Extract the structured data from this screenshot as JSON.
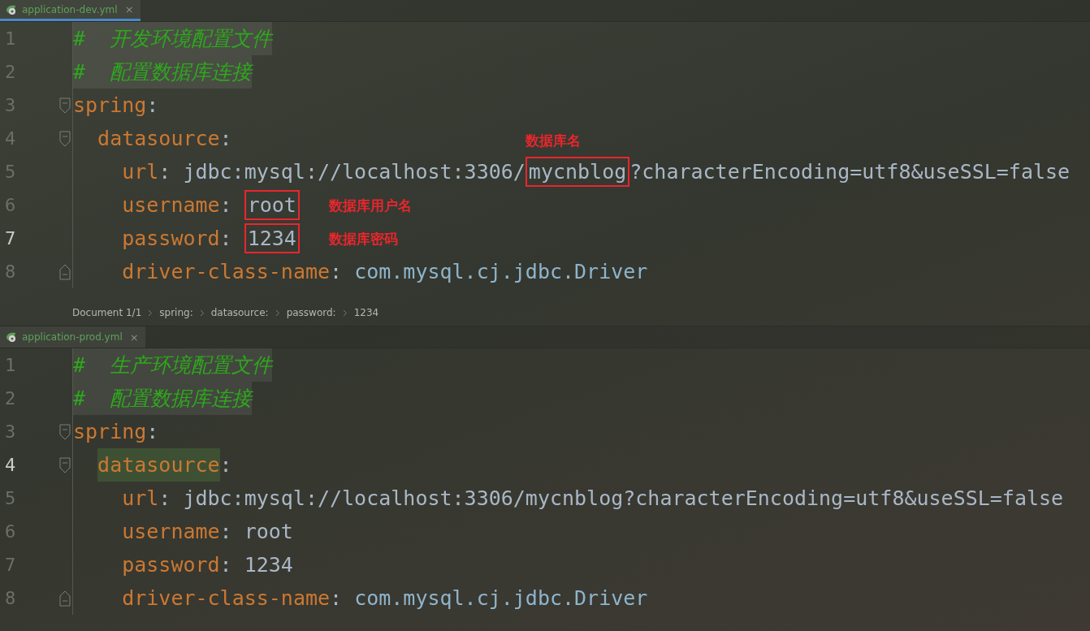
{
  "editors": [
    {
      "tab": {
        "label": "application-dev.yml",
        "close": "×",
        "selected": true
      },
      "lines": [
        {
          "number": "1",
          "current": false,
          "fold_start": false,
          "fold_end": false,
          "tokens": [
            {
              "kind": "comment",
              "text": "#  开发环境配置文件"
            }
          ]
        },
        {
          "number": "2",
          "current": false,
          "fold_start": false,
          "fold_end": false,
          "tokens": [
            {
              "kind": "comment",
              "text": "#  配置数据库连接"
            }
          ]
        },
        {
          "number": "3",
          "current": false,
          "fold_start": true,
          "fold_end": false,
          "tokens": [
            {
              "kind": "key",
              "text": "spring"
            },
            {
              "kind": "punct",
              "text": ":"
            }
          ],
          "children": [
            {
              "number": "4",
              "current": false,
              "fold_start": true,
              "fold_end": false,
              "tokens": [
                {
                  "kind": "key",
                  "text": "datasource"
                },
                {
                  "kind": "punct",
                  "text": ":"
                }
              ],
              "children": [
                {
                  "number": "5",
                  "current": false,
                  "fold_start": false,
                  "fold_end": false,
                  "tokens": [
                    {
                      "kind": "key",
                      "text": "url"
                    },
                    {
                      "kind": "punct",
                      "text": ":"
                    },
                    {
                      "kind": "value",
                      "text": "jdbc:mysql://localhost:3306/"
                    },
                    {
                      "kind": "value",
                      "text": "mycnblog",
                      "note": "数据库名"
                    },
                    {
                      "kind": "value",
                      "text": "?characterEncoding=utf8&useSSL=false"
                    }
                  ]
                },
                {
                  "number": "6",
                  "current": false,
                  "fold_start": false,
                  "fold_end": false,
                  "tokens": [
                    {
                      "kind": "key",
                      "text": "username"
                    },
                    {
                      "kind": "punct",
                      "text": ":"
                    },
                    {
                      "kind": "value",
                      "text": "root",
                      "note": "数据库用户名"
                    }
                  ]
                },
                {
                  "number": "7",
                  "current": true,
                  "fold_start": false,
                  "fold_end": false,
                  "tokens": [
                    {
                      "kind": "key",
                      "text": "password"
                    },
                    {
                      "kind": "punct",
                      "text": ":"
                    },
                    {
                      "kind": "value",
                      "text": "1234",
                      "note": "数据库密码"
                    }
                  ]
                },
                {
                  "number": "8",
                  "current": false,
                  "fold_start": false,
                  "fold_end": true,
                  "tokens": [
                    {
                      "kind": "key",
                      "text": "driver-class-name"
                    },
                    {
                      "kind": "punct",
                      "text": ":"
                    },
                    {
                      "kind": "class",
                      "text": "com.mysql.cj.jdbc.Driver"
                    }
                  ]
                }
              ]
            }
          ]
        }
      ],
      "breadcrumb": [
        "Document 1/1",
        "spring:",
        "datasource:",
        "password:",
        "1234"
      ]
    },
    {
      "tab": {
        "label": "application-prod.yml",
        "close": "×",
        "selected": false
      },
      "lines": [
        {
          "number": "1",
          "current": false,
          "fold_start": false,
          "fold_end": false,
          "tokens": [
            {
              "kind": "comment",
              "text": "#  生产环境配置文件"
            }
          ]
        },
        {
          "number": "2",
          "current": false,
          "fold_start": false,
          "fold_end": false,
          "tokens": [
            {
              "kind": "comment",
              "text": "#  配置数据库连接"
            }
          ]
        },
        {
          "number": "3",
          "current": false,
          "fold_start": true,
          "fold_end": false,
          "tokens": [
            {
              "kind": "key",
              "text": "spring"
            },
            {
              "kind": "punct",
              "text": ":"
            }
          ],
          "children": [
            {
              "number": "4",
              "current": true,
              "fold_start": true,
              "fold_end": false,
              "tokens": [
                {
                  "kind": "key",
                  "text": "datasource",
                  "highlighted": true
                },
                {
                  "kind": "punct",
                  "text": ":"
                }
              ],
              "children": [
                {
                  "number": "5",
                  "current": false,
                  "fold_start": false,
                  "fold_end": false,
                  "tokens": [
                    {
                      "kind": "key",
                      "text": "url"
                    },
                    {
                      "kind": "punct",
                      "text": ":"
                    },
                    {
                      "kind": "value",
                      "text": "jdbc:mysql://localhost:3306/mycnblog?characterEncoding=utf8&useSSL=false"
                    }
                  ]
                },
                {
                  "number": "6",
                  "current": false,
                  "fold_start": false,
                  "fold_end": false,
                  "tokens": [
                    {
                      "kind": "key",
                      "text": "username"
                    },
                    {
                      "kind": "punct",
                      "text": ":"
                    },
                    {
                      "kind": "value",
                      "text": "root"
                    }
                  ]
                },
                {
                  "number": "7",
                  "current": false,
                  "fold_start": false,
                  "fold_end": false,
                  "tokens": [
                    {
                      "kind": "key",
                      "text": "password"
                    },
                    {
                      "kind": "punct",
                      "text": ":"
                    },
                    {
                      "kind": "value",
                      "text": "1234"
                    }
                  ]
                },
                {
                  "number": "8",
                  "current": false,
                  "fold_start": false,
                  "fold_end": true,
                  "tokens": [
                    {
                      "kind": "key",
                      "text": "driver-class-name"
                    },
                    {
                      "kind": "punct",
                      "text": ":"
                    },
                    {
                      "kind": "class",
                      "text": "com.mysql.cj.jdbc.Driver"
                    }
                  ]
                }
              ]
            }
          ]
        }
      ]
    }
  ]
}
